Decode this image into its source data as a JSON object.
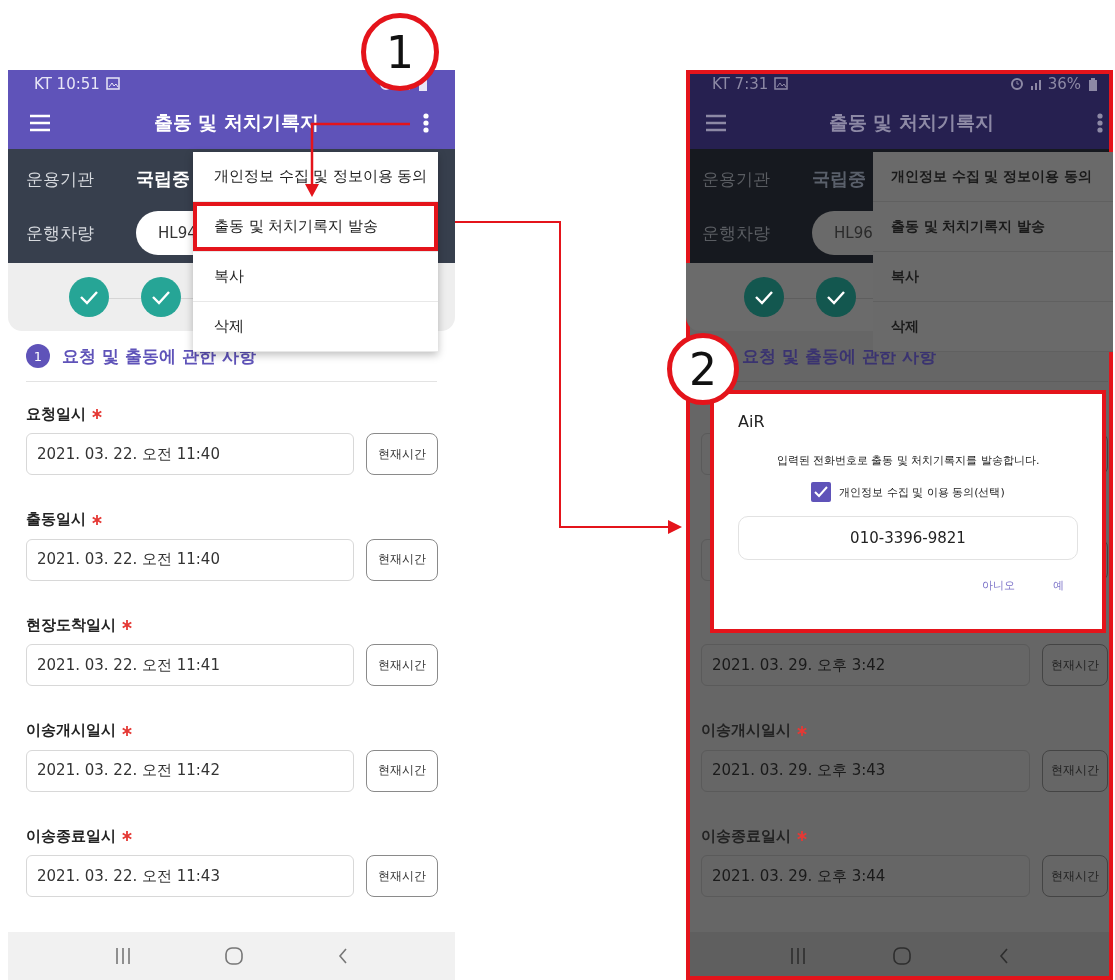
{
  "screens": [
    {
      "dimmed": false,
      "highlighted": false,
      "status_bar": {
        "carrier_time": "KT 10:51"
      },
      "app_bar": {
        "title": "출동 및 처치기록지"
      },
      "info": {
        "org_label": "운용기관",
        "org_value": "국립중",
        "vehicle_label": "운행차량",
        "vehicle_value": "HL94"
      },
      "steps": [
        {
          "done": true
        },
        {
          "done": true
        }
      ],
      "menu": {
        "items": [
          {
            "label": "개인정보 수집 및 정보이용 동의",
            "highlighted": false
          },
          {
            "label": "출동 및 처치기록지 발송",
            "highlighted": true
          },
          {
            "label": "복사",
            "highlighted": false
          },
          {
            "label": "삭제",
            "highlighted": false
          }
        ]
      },
      "section": {
        "number": "1",
        "title": "요청 및 출동에 관한 사항"
      },
      "rows": [
        {
          "kind": "field",
          "label": "요청일시",
          "required": true,
          "value": "2021. 03. 22. 오전 11:40",
          "button": "현재시간"
        },
        {
          "kind": "field",
          "label": "출동일시",
          "required": true,
          "value": "2021. 03. 22. 오전 11:40",
          "button": "현재시간"
        },
        {
          "kind": "field",
          "label": "현장도착일시",
          "required": true,
          "value": "2021. 03. 22. 오전 11:41",
          "button": "현재시간"
        },
        {
          "kind": "field",
          "label": "이송개시일시",
          "required": true,
          "value": "2021. 03. 22. 오전 11:42",
          "button": "현재시간"
        },
        {
          "kind": "field",
          "label": "이송종료일시",
          "required": true,
          "value": "2021. 03. 22. 오전 11:43",
          "button": "현재시간"
        }
      ]
    },
    {
      "dimmed": true,
      "highlighted": true,
      "status_bar": {
        "carrier_time": "KT 7:31",
        "battery": "36%"
      },
      "app_bar": {
        "title": "출동 및 처치기록지"
      },
      "info": {
        "org_label": "운용기관",
        "org_value": "국립중",
        "vehicle_label": "운행차량",
        "vehicle_value": "HL96"
      },
      "steps": [
        {
          "done": true
        },
        {
          "done": true
        }
      ],
      "menu": {
        "items": [
          {
            "label": "개인정보 수집 및 정보이용 동의",
            "highlighted": false
          },
          {
            "label": "출동 및 처치기록지 발송",
            "highlighted": false
          },
          {
            "label": "복사",
            "highlighted": false
          },
          {
            "label": "삭제",
            "highlighted": false
          }
        ]
      },
      "section": {
        "title": "요청 및 출동에 관한 사항"
      },
      "rows": [
        {
          "kind": "covered"
        },
        {
          "kind": "covered"
        },
        {
          "kind": "field",
          "value": "2021. 03. 29. 오후 3:42",
          "button": "현재시간"
        },
        {
          "kind": "field",
          "label": "이송개시일시",
          "required": true,
          "value": "2021. 03. 29. 오후 3:43",
          "button": "현재시간"
        },
        {
          "kind": "field",
          "label": "이송종료일시",
          "required": true,
          "value": "2021. 03. 29. 오후 3:44",
          "button": "현재시간"
        }
      ],
      "dialog": {
        "highlighted": true,
        "title": "AiR",
        "message": "입력된 전화번호로 출동 및 처치기록지를 발송합니다.",
        "checkbox": {
          "label": "개인정보 수집 및 이용 동의(선택)",
          "checked": true
        },
        "phone": "010-3396-9821",
        "buttons": [
          "아니오",
          "예"
        ]
      }
    }
  ],
  "callouts": [
    {
      "number": "1"
    },
    {
      "number": "2"
    }
  ]
}
